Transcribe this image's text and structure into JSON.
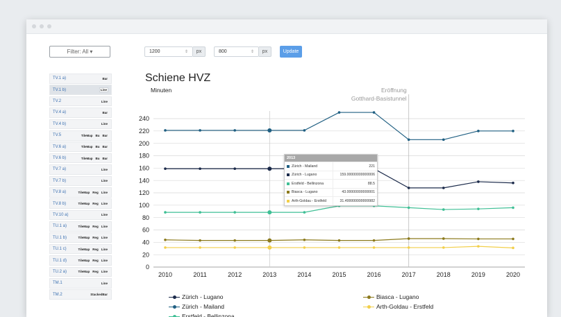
{
  "filter": {
    "label": "Filter: All ▾"
  },
  "topbar": {
    "width": "1200",
    "width_unit": "px",
    "height": "800",
    "height_unit": "px",
    "update_label": "Update"
  },
  "sidebar": {
    "items": [
      {
        "label": "TV.1 a)",
        "tags": [
          "Bar"
        ]
      },
      {
        "label": "TV.1 b)",
        "tags": [
          "Line"
        ],
        "active": true
      },
      {
        "label": "TV.2",
        "tags": [
          "Line"
        ]
      },
      {
        "label": "TV.4 a)",
        "tags": [
          "Bar"
        ]
      },
      {
        "label": "TV.4 b)",
        "tags": [
          "Line"
        ]
      },
      {
        "label": "TV.5",
        "tags": [
          "TileMap",
          "Bu",
          "Bar"
        ]
      },
      {
        "label": "TV.6 a)",
        "tags": [
          "TileMap",
          "Bu",
          "Bar"
        ]
      },
      {
        "label": "TV.6 b)",
        "tags": [
          "TileMap",
          "Bu",
          "Bar"
        ]
      },
      {
        "label": "TV.7 a)",
        "tags": [
          "Line"
        ]
      },
      {
        "label": "TV.7 b)",
        "tags": [
          "Line"
        ]
      },
      {
        "label": "TV.8 a)",
        "tags": [
          "TileMap",
          "Reg",
          "Line"
        ]
      },
      {
        "label": "TV.8 b)",
        "tags": [
          "TileMap",
          "Reg",
          "Line"
        ]
      },
      {
        "label": "TV.10 a)",
        "tags": [
          "Line"
        ]
      },
      {
        "label": "TU.1 a)",
        "tags": [
          "TileMap",
          "Reg",
          "Line"
        ]
      },
      {
        "label": "TU.1 b)",
        "tags": [
          "TileMap",
          "Reg",
          "Line"
        ]
      },
      {
        "label": "TU.1 c)",
        "tags": [
          "TileMap",
          "Reg",
          "Line"
        ]
      },
      {
        "label": "TU.1 d)",
        "tags": [
          "TileMap",
          "Reg",
          "Line"
        ]
      },
      {
        "label": "TU.2 a)",
        "tags": [
          "TileMap",
          "Reg",
          "Line"
        ]
      },
      {
        "label": "TM.1",
        "tags": [
          "Line"
        ]
      },
      {
        "label": "TM.2",
        "tags": [
          "StackedBar"
        ]
      }
    ]
  },
  "chart_data": {
    "type": "line",
    "title": "Schiene HVZ",
    "ylabel": "Minuten",
    "x": [
      2010,
      2011,
      2012,
      2013,
      2014,
      2015,
      2016,
      2017,
      2018,
      2019,
      2020
    ],
    "ylim": [
      0,
      240
    ],
    "yticks": [
      0,
      20,
      40,
      60,
      80,
      100,
      120,
      140,
      160,
      180,
      200,
      220,
      240
    ],
    "annotation": {
      "x": 2017,
      "line1": "Eröffnung",
      "line2": "Gotthard-Basistunnel"
    },
    "hover_x": 2013,
    "series": [
      {
        "name": "Zürich - Lugano",
        "color": "#1b2a4a",
        "values": [
          159,
          159,
          159,
          159,
          159,
          159,
          159,
          128,
          128,
          138,
          136
        ]
      },
      {
        "name": "Zürich - Mailand",
        "color": "#1f5f82",
        "values": [
          221,
          221,
          221,
          221,
          221,
          250,
          250,
          206,
          206,
          220,
          220
        ]
      },
      {
        "name": "Erstfeld - Bellinzona",
        "color": "#3fbf95",
        "values": [
          88.5,
          88.5,
          88.5,
          88.5,
          88.5,
          99,
          99,
          96,
          93,
          94,
          96
        ]
      },
      {
        "name": "Biasca - Lugano",
        "color": "#8c7a1c",
        "values": [
          44,
          43,
          43,
          43,
          44,
          43,
          43,
          46,
          46,
          45.5,
          45.5
        ]
      },
      {
        "name": "Arth-Goldau - Erstfeld",
        "color": "#f2cf4a",
        "values": [
          31.5,
          31.5,
          31.5,
          31.5,
          31.5,
          31.5,
          31.5,
          31.5,
          31.5,
          33.5,
          31
        ]
      }
    ],
    "legend": [
      "Zürich - Lugano",
      "Biasca - Lugano",
      "Zürich - Mailand",
      "Arth-Goldau - Erstfeld",
      "Erstfeld - Bellinzona"
    ]
  },
  "tooltip": {
    "title": "2013",
    "rows": [
      {
        "name": "Zürich - Mailand",
        "value": "221",
        "color": "#1f5f82"
      },
      {
        "name": "Zürich - Lugano",
        "value": "159.00000000000006",
        "color": "#1b2a4a"
      },
      {
        "name": "Erstfeld - Bellinzona",
        "value": "88.5",
        "color": "#3fbf95"
      },
      {
        "name": "Biasca - Lugano",
        "value": "43.00000000000001",
        "color": "#8c7a1c"
      },
      {
        "name": "Arth-Goldau - Erstfeld",
        "value": "31.499999999999982",
        "color": "#f2cf4a"
      }
    ]
  }
}
